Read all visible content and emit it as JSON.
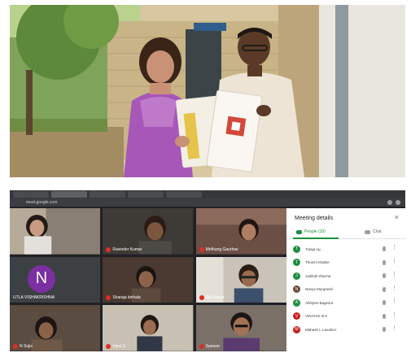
{
  "meet": {
    "address": "meet.google.com",
    "tiles": [
      {
        "name": "",
        "kind": "video",
        "palette": "room-girl"
      },
      {
        "name": "Ravinder Kumar",
        "kind": "video",
        "palette": "face-dark"
      },
      {
        "name": "Mrithung Gaurhav",
        "kind": "video",
        "palette": "face-girl"
      },
      {
        "name": "UTLA VISHAKRISHNA",
        "kind": "avatar",
        "initial": "N"
      },
      {
        "name": "Sharaja kinhala",
        "kind": "video",
        "palette": "face-boy"
      },
      {
        "name": "Ajit Kumar",
        "kind": "video",
        "palette": "face-glasses"
      },
      {
        "name": "N Sojis",
        "kind": "video",
        "palette": "room-dark"
      },
      {
        "name": "Vipul S",
        "kind": "video",
        "palette": "room-light"
      },
      {
        "name": "Sameer",
        "kind": "video",
        "palette": "face-man"
      }
    ]
  },
  "panel": {
    "title": "Meeting details",
    "close": "×",
    "people_tab": "People (10)",
    "chat_tab": "Chat",
    "people": [
      {
        "name": "Tulaja Ag",
        "initial": "T",
        "color": "#1e8e3e"
      },
      {
        "name": "Thusmi Khalse",
        "initial": "T",
        "color": "#1e8e3e"
      },
      {
        "name": "Jaikhali sharma",
        "initial": "J",
        "color": "#1e8e3e"
      },
      {
        "name": "Navya Murgeesh",
        "initial": "N",
        "color": "#6b4a3a"
      },
      {
        "name": "Abhijeet Bagesut",
        "initial": "A",
        "color": "#1e8e3e"
      },
      {
        "name": "VINAYAK B K",
        "initial": "V",
        "color": "#c5221f"
      },
      {
        "name": "Mahesh L Lanahiro",
        "initial": "M",
        "color": "#c5221f"
      }
    ]
  },
  "icons": {
    "close": "close-icon",
    "people": "people-icon",
    "chat": "chat-icon",
    "mic": "mic-icon",
    "more": "more-vert-icon"
  }
}
